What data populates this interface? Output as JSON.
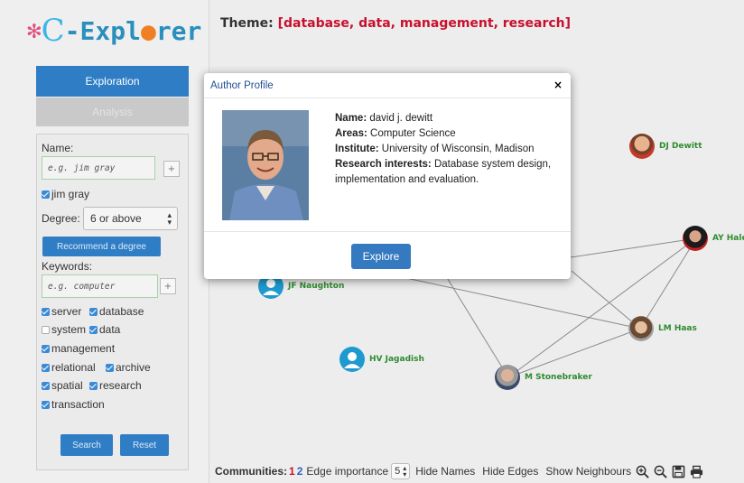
{
  "logo": {
    "x": "✻",
    "c": "C",
    "text1": "-Expl",
    "o": "●",
    "text2": "rer"
  },
  "left": {
    "tab_exploration": "Exploration",
    "tab_analysis": "Analysis",
    "name_label": "Name:",
    "name_placeholder": "e.g. jim gray",
    "plus": "+",
    "checked_name": "jim gray",
    "degree_label": "Degree:",
    "degree_value": "6 or above",
    "recommend_button": "Recommend a degree",
    "keywords_label": "Keywords:",
    "keywords_placeholder": "e.g. computer",
    "keywords": [
      {
        "label": "server",
        "checked": true
      },
      {
        "label": "database",
        "checked": true
      },
      {
        "label": "system",
        "checked": false
      },
      {
        "label": "data",
        "checked": true
      },
      {
        "label": "management",
        "checked": true
      },
      {
        "label": "relational",
        "checked": true
      },
      {
        "label": "archive",
        "checked": true
      },
      {
        "label": "spatial",
        "checked": true
      },
      {
        "label": "research",
        "checked": true
      },
      {
        "label": "transaction",
        "checked": true
      }
    ],
    "search_button": "Search",
    "reset_button": "Reset"
  },
  "theme": {
    "label": "Theme:",
    "keywords": "[database, data, management, research]"
  },
  "graph": {
    "nodes": [
      {
        "label": "DJ Dewitt"
      },
      {
        "label": "AY Hale"
      },
      {
        "label": "LM Haas"
      },
      {
        "label": "JF Naughton"
      },
      {
        "label": "HV Jagadish"
      },
      {
        "label": "M Stonebraker"
      }
    ]
  },
  "modal": {
    "title": "Author Profile",
    "close": "×",
    "name_label": "Name:",
    "name": "david j. dewitt",
    "areas_label": "Areas:",
    "areas": "Computer Science",
    "institute_label": "Institute:",
    "institute": "University of Wisconsin, Madison",
    "interests_label": "Research interests:",
    "interests": "Database system design, implementation and evaluation.",
    "explore_button": "Explore"
  },
  "toolbar": {
    "communities_label": "Communities:",
    "community_1": "1",
    "community_2": "2",
    "edge_importance_label": "Edge importance",
    "edge_importance_value": "5",
    "hide_names": "Hide Names",
    "hide_edges": "Hide Edges",
    "show_neighbours": "Show Neighbours"
  },
  "colors": {
    "accent": "#2f7ec5",
    "theme_keywords": "#c8102e",
    "node_label": "#2e8b2e",
    "community_1": "#c8102e",
    "community_2": "#2f5fc5"
  }
}
